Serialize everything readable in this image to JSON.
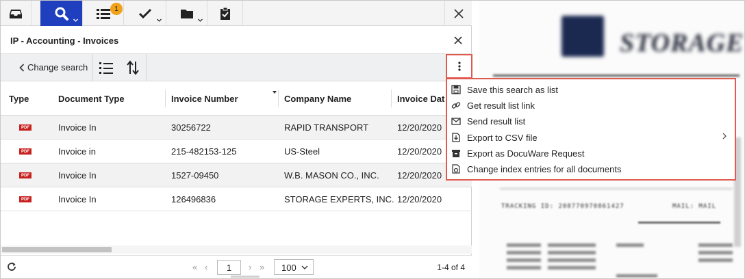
{
  "topbar": {
    "buttons": [
      {
        "name": "tray-icon"
      },
      {
        "name": "search-icon",
        "active": true
      },
      {
        "name": "list-icon",
        "badge": "1"
      },
      {
        "name": "checkmark-icon"
      },
      {
        "name": "folder-icon"
      },
      {
        "name": "clipboard-check-icon"
      }
    ]
  },
  "panel": {
    "title": "IP - Accounting - Invoices"
  },
  "toolbar": {
    "change_search_label": "Change search"
  },
  "table": {
    "columns": [
      "Type",
      "Document Type",
      "Invoice Number",
      "Company Name",
      "Invoice Dat"
    ],
    "rows": [
      {
        "type": "PDF",
        "document_type": "Invoice In",
        "invoice_number": "30256722",
        "company_name": "RAPID TRANSPORT",
        "invoice_date": "12/20/2020"
      },
      {
        "type": "PDF",
        "document_type": "Invoice in",
        "invoice_number": "215-482153-125",
        "company_name": "US-Steel",
        "invoice_date": "12/20/2020"
      },
      {
        "type": "PDF",
        "document_type": "Invoice In",
        "invoice_number": "1527-09450",
        "company_name": "W.B. MASON CO., INC.",
        "invoice_date": "12/20/2020"
      },
      {
        "type": "PDF",
        "document_type": "Invoice In",
        "invoice_number": "126496836",
        "company_name": "STORAGE EXPERTS, INC.",
        "invoice_date": "12/20/2020"
      }
    ]
  },
  "footer": {
    "current_page": "1",
    "page_size": "100",
    "result_count": "1-4 of 4"
  },
  "menu": {
    "items": [
      {
        "label": "Save this search as list",
        "icon": "save-icon"
      },
      {
        "label": "Get result list link",
        "icon": "link-icon"
      },
      {
        "label": "Send result list",
        "icon": "envelope-icon"
      },
      {
        "label": "Export to CSV file",
        "icon": "export-icon",
        "submenu": true
      },
      {
        "label": "Export as DocuWare Request",
        "icon": "archive-icon"
      },
      {
        "label": "Change index entries for all documents",
        "icon": "edit-index-icon"
      }
    ]
  },
  "preview": {
    "brand_text": "STORAGE E",
    "tracking_text": "TRACKING ID: 208770970861427",
    "mail_text": "MAIL: MAIL"
  },
  "colors": {
    "accent": "#1f3fbf",
    "badge": "#f0a11a",
    "highlight_border": "#e05a4f",
    "pdf_icon": "#c8201e"
  }
}
